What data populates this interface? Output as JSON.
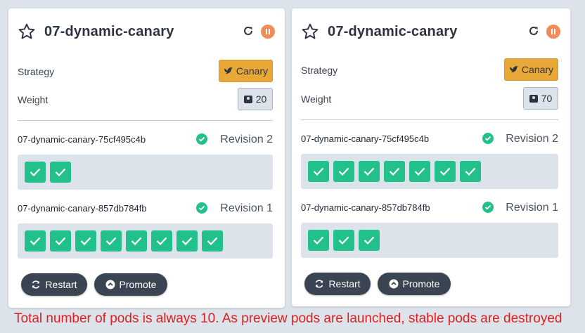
{
  "rollouts": [
    {
      "title": "07-dynamic-canary",
      "strategy_label": "Strategy",
      "strategy_value": "Canary",
      "weight_label": "Weight",
      "weight_value": "20",
      "replicasets": [
        {
          "name": "07-dynamic-canary-75cf495c4b",
          "revision": "Revision 2",
          "pods": 2
        },
        {
          "name": "07-dynamic-canary-857db784fb",
          "revision": "Revision 1",
          "pods": 8
        }
      ],
      "restart_label": "Restart",
      "promote_label": "Promote"
    },
    {
      "title": "07-dynamic-canary",
      "strategy_label": "Strategy",
      "strategy_value": "Canary",
      "weight_label": "Weight",
      "weight_value": "70",
      "replicasets": [
        {
          "name": "07-dynamic-canary-75cf495c4b",
          "revision": "Revision 2",
          "pods": 7
        },
        {
          "name": "07-dynamic-canary-857db784fb",
          "revision": "Revision 1",
          "pods": 3
        }
      ],
      "restart_label": "Restart",
      "promote_label": "Promote"
    }
  ],
  "caption": "Total number of pods is always 10. As preview pods are launched, stable pods are destroyed",
  "colors": {
    "healthy": "#22c08a",
    "canary": "#e8a838",
    "pause": "#f08c5a",
    "caption": "#e02020"
  },
  "icons": [
    "star-icon",
    "refresh-icon",
    "pause-icon",
    "canary-bird-icon",
    "weight-icon",
    "check-circle-icon",
    "pod-check-icon",
    "restart-icon",
    "promote-icon"
  ]
}
